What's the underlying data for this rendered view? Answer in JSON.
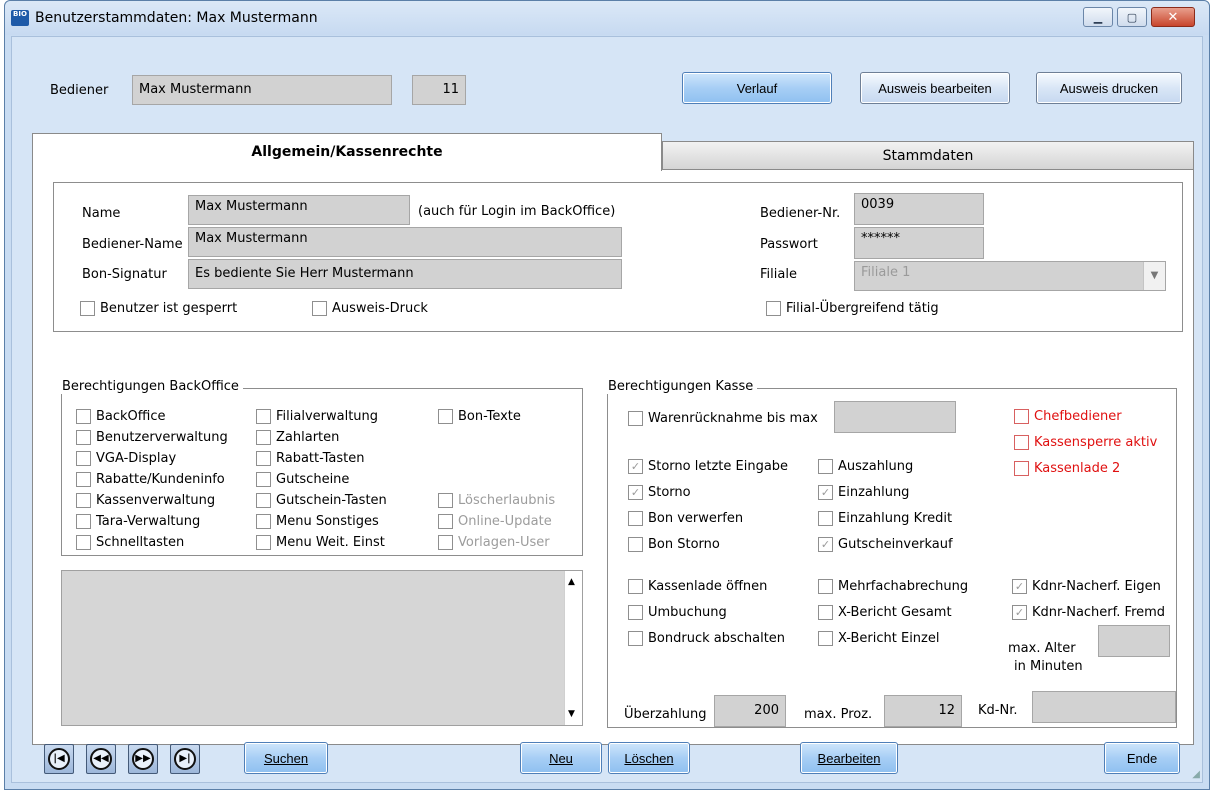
{
  "window": {
    "title": "Benutzerstammdaten: Max Mustermann",
    "icon_text": "BIO"
  },
  "header": {
    "bediener_label": "Bediener",
    "bediener_value": "Max Mustermann",
    "bediener_id": "11",
    "verlauf_label": "Verlauf",
    "ausweis_bearbeiten_label": "Ausweis bearbeiten",
    "ausweis_drucken_label": "Ausweis drucken"
  },
  "tabs": {
    "allgemein": "Allgemein/Kassenrechte",
    "stammdaten": "Stammdaten"
  },
  "form": {
    "name_label": "Name",
    "name_value": "Max Mustermann",
    "name_hint": "(auch für Login im BackOffice)",
    "bediener_name_label": "Bediener-Name",
    "bediener_name_value": "Max Mustermann",
    "bon_signatur_label": "Bon-Signatur",
    "bon_signatur_value": "Es bediente Sie Herr Mustermann",
    "bediener_nr_label": "Bediener-Nr.",
    "bediener_nr_value": "0039",
    "passwort_label": "Passwort",
    "passwort_value": "******",
    "filiale_label": "Filiale",
    "filiale_value": "Filiale 1",
    "benutzer_gesperrt": "Benutzer ist gesperrt",
    "ausweis_druck": "Ausweis-Druck",
    "filial_uebergreifend": "Filial-Übergreifend tätig"
  },
  "backoffice": {
    "legend": "Berechtigungen BackOffice",
    "col1": [
      "BackOffice",
      "Benutzerverwaltung",
      "VGA-Display",
      "Rabatte/Kundeninfo",
      "Kassenverwaltung",
      "Tara-Verwaltung",
      "Schnelltasten"
    ],
    "col2": [
      "Filialverwaltung",
      "Zahlarten",
      "Rabatt-Tasten",
      "Gutscheine",
      "Gutschein-Tasten",
      "Menu Sonstiges",
      "Menu Weit. Einst"
    ],
    "col3_top": "Bon-Texte",
    "col3_disabled": [
      "Löscherlaubnis",
      "Online-Update",
      "Vorlagen-User"
    ]
  },
  "kasse": {
    "legend": "Berechtigungen Kasse",
    "warenruecknahme_label": "Warenrücknahme bis max",
    "warenruecknahme_value": "",
    "red_options": [
      "Chefbediener",
      "Kassensperre aktiv",
      "Kassenlade 2"
    ],
    "group1_left": [
      {
        "label": "Storno letzte Eingabe",
        "checked": true
      },
      {
        "label": "Storno",
        "checked": true
      },
      {
        "label": "Bon verwerfen",
        "checked": false
      },
      {
        "label": "Bon Storno",
        "checked": false
      }
    ],
    "group1_right": [
      {
        "label": "Auszahlung",
        "checked": false
      },
      {
        "label": "Einzahlung",
        "checked": true
      },
      {
        "label": "Einzahlung Kredit",
        "checked": false
      },
      {
        "label": "Gutscheinverkauf",
        "checked": true
      }
    ],
    "group2_left": [
      "Kassenlade öffnen",
      "Umbuchung",
      "Bondruck abschalten"
    ],
    "group2_mid": [
      "Mehrfachabrechung",
      "X-Bericht Gesamt",
      "X-Bericht Einzel"
    ],
    "group2_right": [
      {
        "label": "Kdnr-Nacherf. Eigen",
        "checked": true
      },
      {
        "label": "Kdnr-Nacherf. Fremd",
        "checked": true
      }
    ],
    "max_alter_label_1": "max. Alter",
    "max_alter_label_2": "in Minuten",
    "max_alter_value": "",
    "ueberzahlung_label": "Überzahlung",
    "ueberzahlung_value": "200",
    "max_proz_label": "max. Proz.",
    "max_proz_value": "12",
    "kdnr_label": "Kd-Nr.",
    "kdnr_value": ""
  },
  "footer": {
    "nav_glyphs": [
      "|◀",
      "◀◀",
      "▶▶",
      "▶|"
    ],
    "suchen_label": "Suchen",
    "neu_label": "Neu",
    "loeschen_label": "Löschen",
    "bearbeiten_label": "Bearbeiten",
    "ende_label": "Ende"
  },
  "check_glyph": "✓",
  "colors": {
    "window_bg": "#d6e5f6",
    "field_bg": "#d2d2d2",
    "red_text": "#e01010"
  }
}
